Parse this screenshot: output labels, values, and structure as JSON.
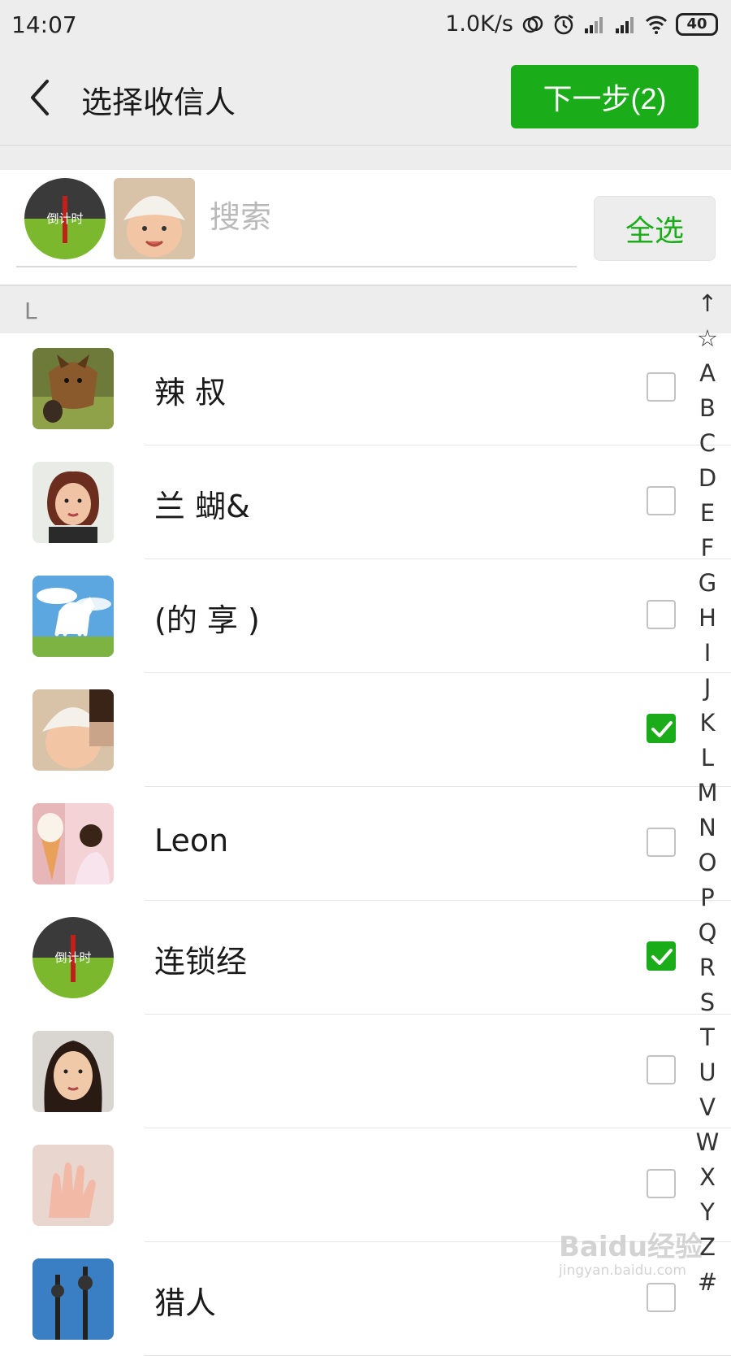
{
  "status_bar": {
    "time": "14:07",
    "net_speed": "1.0K/s",
    "battery": "40"
  },
  "header": {
    "title": "选择收信人",
    "next_button": "下一步(2)"
  },
  "selection": {
    "search_placeholder": "搜索",
    "select_all": "全选"
  },
  "section": {
    "letter": "L"
  },
  "contacts": [
    {
      "name": "辣 叔",
      "checked": false,
      "avatar": "dog-photo"
    },
    {
      "name": "兰 蝴&",
      "checked": false,
      "avatar": "woman-photo"
    },
    {
      "name": "(的 享 )",
      "checked": false,
      "avatar": "horse-photo"
    },
    {
      "name": "",
      "checked": true,
      "avatar": "baby-photo"
    },
    {
      "name": "Leon",
      "checked": false,
      "avatar": "girl-photo"
    },
    {
      "name": "连锁经",
      "checked": true,
      "avatar": "countdown-logo"
    },
    {
      "name": "",
      "checked": false,
      "avatar": "child-photo"
    },
    {
      "name": "",
      "checked": false,
      "avatar": "hand-photo"
    },
    {
      "name": "猎人",
      "checked": false,
      "avatar": "tower-photo"
    }
  ],
  "index_letters": [
    "↑",
    "☆",
    "A",
    "B",
    "C",
    "D",
    "E",
    "F",
    "G",
    "H",
    "I",
    "J",
    "K",
    "L",
    "M",
    "N",
    "O",
    "P",
    "Q",
    "R",
    "S",
    "T",
    "U",
    "V",
    "W",
    "X",
    "Y",
    "Z",
    "#"
  ],
  "countdown_logo_text": "倒计时",
  "watermark": {
    "brand": "Baidu经验",
    "url": "jingyan.baidu.com"
  },
  "colors": {
    "accent": "#1aad19",
    "background": "#ededed",
    "divider": "#e4e4e4"
  }
}
